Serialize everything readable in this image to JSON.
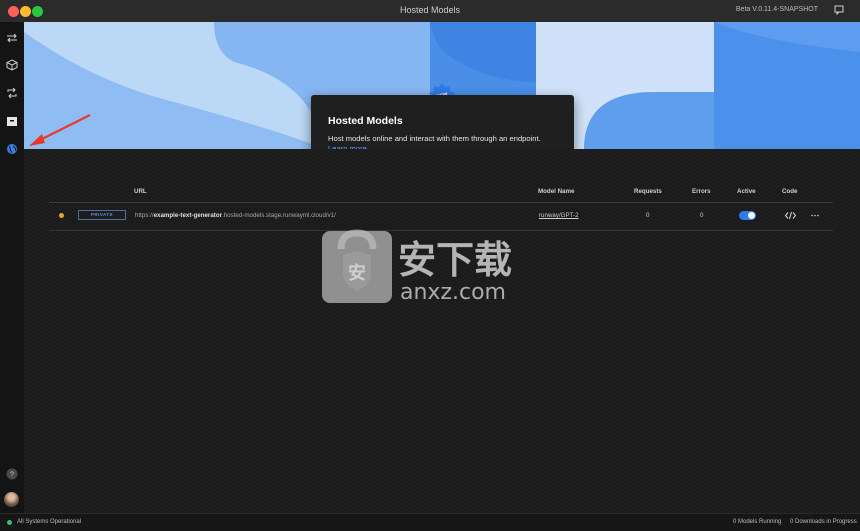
{
  "window": {
    "title": "Hosted Models",
    "version": "Beta V.0.11.4-SNAPSHOT"
  },
  "sidebar": {
    "items": [
      {
        "icon": "arrows-swap-icon"
      },
      {
        "icon": "cube-icon"
      },
      {
        "icon": "repeat-icon"
      },
      {
        "icon": "archive-icon"
      },
      {
        "icon": "globe-icon"
      }
    ]
  },
  "popover": {
    "badge": "NEW",
    "title": "Hosted Models",
    "body": "Host models online and interact with them through an endpoint.",
    "link": "Learn more."
  },
  "table": {
    "headers": {
      "url": "URL",
      "model_name": "Model Name",
      "requests": "Requests",
      "errors": "Errors",
      "active": "Active",
      "code": "Code"
    },
    "rows": [
      {
        "visibility": "PRIVATE",
        "url_prefix": "https://",
        "url_name": "example-text-generator",
        "url_suffix": ".hosted-models.stage.runwayml.cloud/v1/",
        "model_name": "runway/GPT-2",
        "requests": "0",
        "errors": "0",
        "active": true
      }
    ]
  },
  "watermark": {
    "text_cn": "安下载",
    "text_en": "anxz.com"
  },
  "footer": {
    "status": "All Systems Operational",
    "models_running": "0 Models Running",
    "downloads": "0 Downloads in Progress"
  },
  "colors": {
    "accent": "#2f7be8",
    "status_dot": "#e8a526",
    "operational": "#33c26a",
    "arrow": "#e8392a"
  }
}
